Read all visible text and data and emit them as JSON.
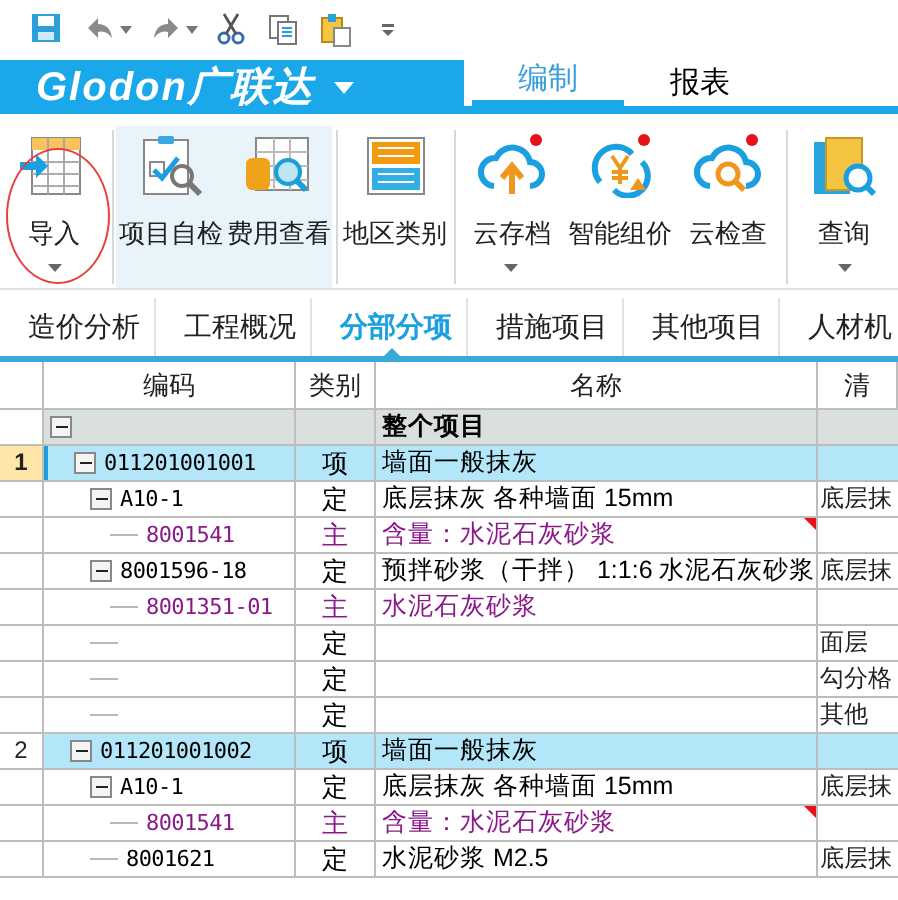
{
  "quick_access": {
    "items": [
      {
        "kind": "save"
      },
      {
        "kind": "undo",
        "dropdown": true
      },
      {
        "kind": "redo",
        "dropdown": true
      },
      {
        "kind": "cut"
      },
      {
        "kind": "copy"
      },
      {
        "kind": "paste"
      },
      {
        "kind": "customize"
      }
    ]
  },
  "header": {
    "logo": "Glodon广联达",
    "tabs": [
      {
        "label": "编制",
        "selected": true
      },
      {
        "label": "报表",
        "selected": false
      }
    ]
  },
  "ribbon": {
    "groups": [
      [
        {
          "label": "导入",
          "kind": "import",
          "dropdown": true,
          "circled": true,
          "highlighted": false,
          "badge": false
        }
      ],
      [
        {
          "label": "项目自检",
          "kind": "check",
          "dropdown": false,
          "circled": false,
          "highlighted": true,
          "badge": false
        },
        {
          "label": "费用查看",
          "kind": "cost",
          "dropdown": false,
          "circled": false,
          "highlighted": true,
          "badge": false
        }
      ],
      [
        {
          "label": "地区类别",
          "kind": "region",
          "dropdown": false,
          "circled": false,
          "highlighted": false,
          "badge": false
        }
      ],
      [
        {
          "label": "云存档",
          "kind": "cloud-up",
          "dropdown": true,
          "circled": false,
          "highlighted": false,
          "badge": true
        },
        {
          "label": "智能组价",
          "kind": "cloud-price",
          "dropdown": false,
          "circled": false,
          "highlighted": false,
          "badge": true
        },
        {
          "label": "云检查",
          "kind": "cloud-check",
          "dropdown": false,
          "circled": false,
          "highlighted": false,
          "badge": true
        }
      ],
      [
        {
          "label": "查询",
          "kind": "query",
          "dropdown": true,
          "circled": false,
          "highlighted": false,
          "badge": false
        }
      ]
    ]
  },
  "tabs": [
    {
      "label": "造价分析",
      "selected": false
    },
    {
      "label": "工程概况",
      "selected": false
    },
    {
      "label": "分部分项",
      "selected": true
    },
    {
      "label": "措施项目",
      "selected": false
    },
    {
      "label": "其他项目",
      "selected": false
    },
    {
      "label": "人材机",
      "selected": false
    }
  ],
  "table": {
    "columns": [
      "编码",
      "类别",
      "名称",
      "清"
    ],
    "rows": [
      {
        "kind": "root",
        "name": "整个项目",
        "expanded": true,
        "children": [
          {
            "kind": "bill",
            "num": "1",
            "current": true,
            "code": "011201001001",
            "type": "项",
            "name": "墙面一般抹灰",
            "expanded": true,
            "children": [
              {
                "kind": "quota",
                "code": "A10-1",
                "type": "定",
                "name": "底层抹灰 各种墙面 15mm",
                "column_4": "底层抹",
                "expanded": true,
                "children": [
                  {
                    "kind": "material",
                    "code": "8001541",
                    "type": "主",
                    "name": "含量：水泥石灰砂浆",
                    "flagged": true
                  }
                ]
              },
              {
                "kind": "quota",
                "code": "8001596-18",
                "type": "定",
                "name": "预拌砂浆（干拌） 1:1:6 水泥石灰砂浆",
                "column_4": "底层抹",
                "expanded": true,
                "children": [
                  {
                    "kind": "material",
                    "code": "8001351-01",
                    "type": "主",
                    "name": "水泥石灰砂浆",
                    "flagged": false
                  }
                ]
              },
              {
                "kind": "quota",
                "type": "定",
                "column_4": "面层"
              },
              {
                "kind": "quota",
                "type": "定",
                "column_4": "勾分格"
              },
              {
                "kind": "quota",
                "type": "定",
                "column_4": "其他"
              }
            ]
          },
          {
            "kind": "bill",
            "num": "2",
            "current": false,
            "code": "011201001002",
            "type": "项",
            "name": "墙面一般抹灰",
            "expanded": true,
            "children": [
              {
                "kind": "quota",
                "code": "A10-1",
                "type": "定",
                "name": "底层抹灰 各种墙面 15mm",
                "column_4": "底层抹",
                "expanded": true,
                "children": [
                  {
                    "kind": "material",
                    "code": "8001541",
                    "type": "主",
                    "name": "含量：水泥石灰砂浆",
                    "flagged": true
                  }
                ]
              },
              {
                "kind": "quota",
                "code": "8001621",
                "type": "定",
                "name": "水泥砂浆 M2.5",
                "column_4": "底层抹"
              }
            ]
          }
        ]
      }
    ]
  }
}
